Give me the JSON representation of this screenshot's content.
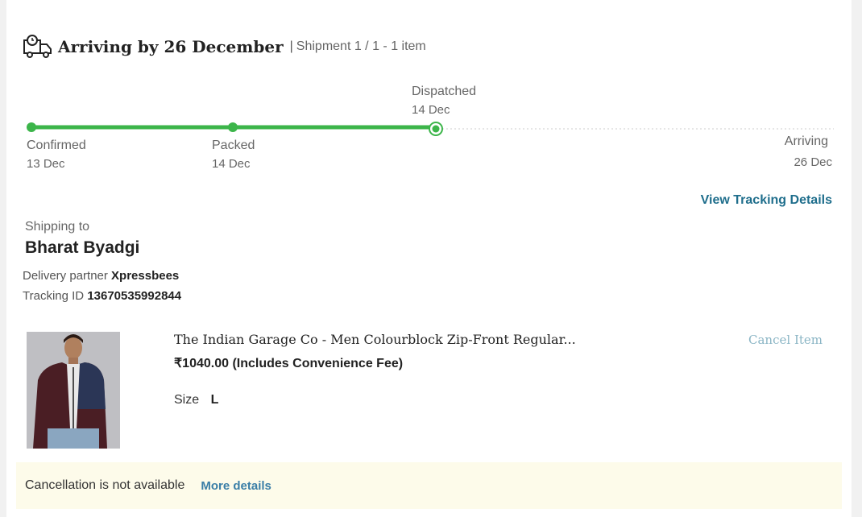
{
  "header": {
    "title": "Arriving by 26 December",
    "separator": "|",
    "shipment": "Shipment 1 / 1 - 1 item"
  },
  "timeline": {
    "steps": [
      {
        "label": "Confirmed",
        "date": "13 Dec",
        "status": "done"
      },
      {
        "label": "Packed",
        "date": "14 Dec",
        "status": "done"
      },
      {
        "label": "Dispatched",
        "date": "14 Dec",
        "status": "current"
      },
      {
        "label": "Arriving",
        "date": "26 Dec",
        "status": "pending"
      }
    ],
    "color_done": "#3cb54a",
    "color_pending": "#cccccc"
  },
  "tracking_link": "View Tracking Details",
  "shipping": {
    "label": "Shipping to",
    "name": "Bharat Byadgi",
    "partner_label": "Delivery partner",
    "partner": "Xpressbees",
    "tracking_label": "Tracking ID",
    "tracking_id": "13670535992844"
  },
  "product": {
    "title": "The Indian Garage Co - Men Colourblock Zip-Front Regular...",
    "price": "₹1040.00 (Includes Convenience Fee)",
    "size_label": "Size",
    "size": "L",
    "cancel_label": "Cancel Item"
  },
  "notice": {
    "message": "Cancellation is not available",
    "link": "More details",
    "background": "#fdfbea"
  }
}
